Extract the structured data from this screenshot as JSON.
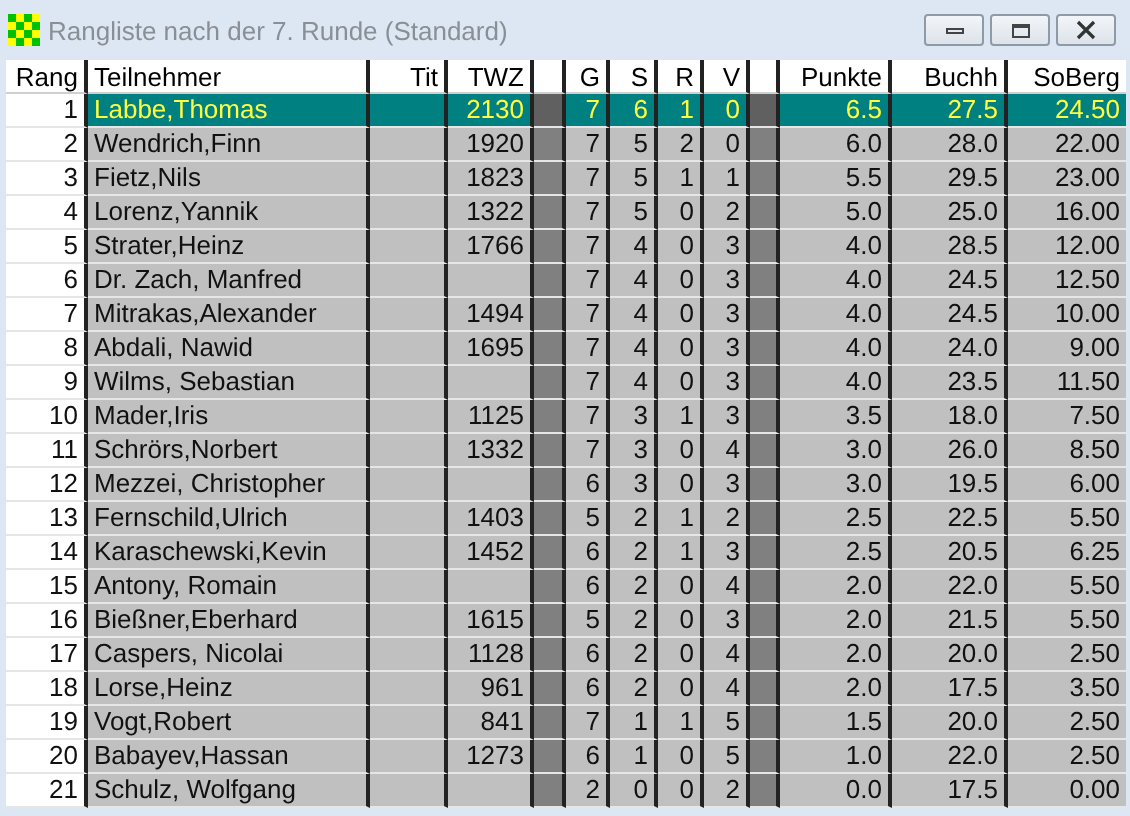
{
  "window": {
    "title": "Rangliste nach der 7. Runde (Standard)"
  },
  "table": {
    "columns": [
      "Rang",
      "Teilnehmer",
      "Tit",
      "TWZ",
      "G",
      "S",
      "R",
      "V",
      "Punkte",
      "Buchh",
      "SoBerg"
    ],
    "rows": [
      {
        "rang": "1",
        "name": "Labbe,Thomas",
        "twz": "2130",
        "g": "7",
        "s": "6",
        "r": "1",
        "v": "0",
        "punkte": "6.5",
        "buchh": "27.5",
        "soberg": "24.50",
        "selected": true
      },
      {
        "rang": "2",
        "name": "Wendrich,Finn",
        "twz": "1920",
        "g": "7",
        "s": "5",
        "r": "2",
        "v": "0",
        "punkte": "6.0",
        "buchh": "28.0",
        "soberg": "22.00",
        "selected": false
      },
      {
        "rang": "3",
        "name": "Fietz,Nils",
        "twz": "1823",
        "g": "7",
        "s": "5",
        "r": "1",
        "v": "1",
        "punkte": "5.5",
        "buchh": "29.5",
        "soberg": "23.00",
        "selected": false
      },
      {
        "rang": "4",
        "name": "Lorenz,Yannik",
        "twz": "1322",
        "g": "7",
        "s": "5",
        "r": "0",
        "v": "2",
        "punkte": "5.0",
        "buchh": "25.0",
        "soberg": "16.00",
        "selected": false
      },
      {
        "rang": "5",
        "name": "Strater,Heinz",
        "twz": "1766",
        "g": "7",
        "s": "4",
        "r": "0",
        "v": "3",
        "punkte": "4.0",
        "buchh": "28.5",
        "soberg": "12.00",
        "selected": false
      },
      {
        "rang": "6",
        "name": "Dr. Zach, Manfred",
        "g": "7",
        "s": "4",
        "r": "0",
        "v": "3",
        "punkte": "4.0",
        "buchh": "24.5",
        "soberg": "12.50",
        "selected": false
      },
      {
        "rang": "7",
        "name": "Mitrakas,Alexander",
        "twz": "1494",
        "g": "7",
        "s": "4",
        "r": "0",
        "v": "3",
        "punkte": "4.0",
        "buchh": "24.5",
        "soberg": "10.00",
        "selected": false
      },
      {
        "rang": "8",
        "name": "Abdali, Nawid",
        "twz": "1695",
        "g": "7",
        "s": "4",
        "r": "0",
        "v": "3",
        "punkte": "4.0",
        "buchh": "24.0",
        "soberg": "9.00",
        "selected": false
      },
      {
        "rang": "9",
        "name": "Wilms, Sebastian",
        "g": "7",
        "s": "4",
        "r": "0",
        "v": "3",
        "punkte": "4.0",
        "buchh": "23.5",
        "soberg": "11.50",
        "selected": false
      },
      {
        "rang": "10",
        "name": "Mader,Iris",
        "twz": "1125",
        "g": "7",
        "s": "3",
        "r": "1",
        "v": "3",
        "punkte": "3.5",
        "buchh": "18.0",
        "soberg": "7.50",
        "selected": false
      },
      {
        "rang": "11",
        "name": "Schrörs,Norbert",
        "twz": "1332",
        "g": "7",
        "s": "3",
        "r": "0",
        "v": "4",
        "punkte": "3.0",
        "buchh": "26.0",
        "soberg": "8.50",
        "selected": false
      },
      {
        "rang": "12",
        "name": "Mezzei, Christopher",
        "g": "6",
        "s": "3",
        "r": "0",
        "v": "3",
        "punkte": "3.0",
        "buchh": "19.5",
        "soberg": "6.00",
        "selected": false
      },
      {
        "rang": "13",
        "name": "Fernschild,Ulrich",
        "twz": "1403",
        "g": "5",
        "s": "2",
        "r": "1",
        "v": "2",
        "punkte": "2.5",
        "buchh": "22.5",
        "soberg": "5.50",
        "selected": false
      },
      {
        "rang": "14",
        "name": "Karaschewski,Kevin",
        "twz": "1452",
        "g": "6",
        "s": "2",
        "r": "1",
        "v": "3",
        "punkte": "2.5",
        "buchh": "20.5",
        "soberg": "6.25",
        "selected": false
      },
      {
        "rang": "15",
        "name": "Antony, Romain",
        "g": "6",
        "s": "2",
        "r": "0",
        "v": "4",
        "punkte": "2.0",
        "buchh": "22.0",
        "soberg": "5.50",
        "selected": false
      },
      {
        "rang": "16",
        "name": "Bießner,Eberhard",
        "twz": "1615",
        "g": "5",
        "s": "2",
        "r": "0",
        "v": "3",
        "punkte": "2.0",
        "buchh": "21.5",
        "soberg": "5.50",
        "selected": false
      },
      {
        "rang": "17",
        "name": "Caspers, Nicolai",
        "twz": "1128",
        "g": "6",
        "s": "2",
        "r": "0",
        "v": "4",
        "punkte": "2.0",
        "buchh": "20.0",
        "soberg": "2.50",
        "selected": false
      },
      {
        "rang": "18",
        "name": "Lorse,Heinz",
        "twz": "961",
        "g": "6",
        "s": "2",
        "r": "0",
        "v": "4",
        "punkte": "2.0",
        "buchh": "17.5",
        "soberg": "3.50",
        "selected": false
      },
      {
        "rang": "19",
        "name": "Vogt,Robert",
        "twz": "841",
        "g": "7",
        "s": "1",
        "r": "1",
        "v": "5",
        "punkte": "1.5",
        "buchh": "20.0",
        "soberg": "2.50",
        "selected": false
      },
      {
        "rang": "20",
        "name": "Babayev,Hassan",
        "twz": "1273",
        "g": "6",
        "s": "1",
        "r": "0",
        "v": "5",
        "punkte": "1.0",
        "buchh": "22.0",
        "soberg": "2.50",
        "selected": false
      },
      {
        "rang": "21",
        "name": "Schulz, Wolfgang",
        "g": "2",
        "s": "0",
        "r": "0",
        "v": "2",
        "punkte": "0.0",
        "buchh": "17.5",
        "soberg": "0.00",
        "selected": false
      }
    ]
  }
}
